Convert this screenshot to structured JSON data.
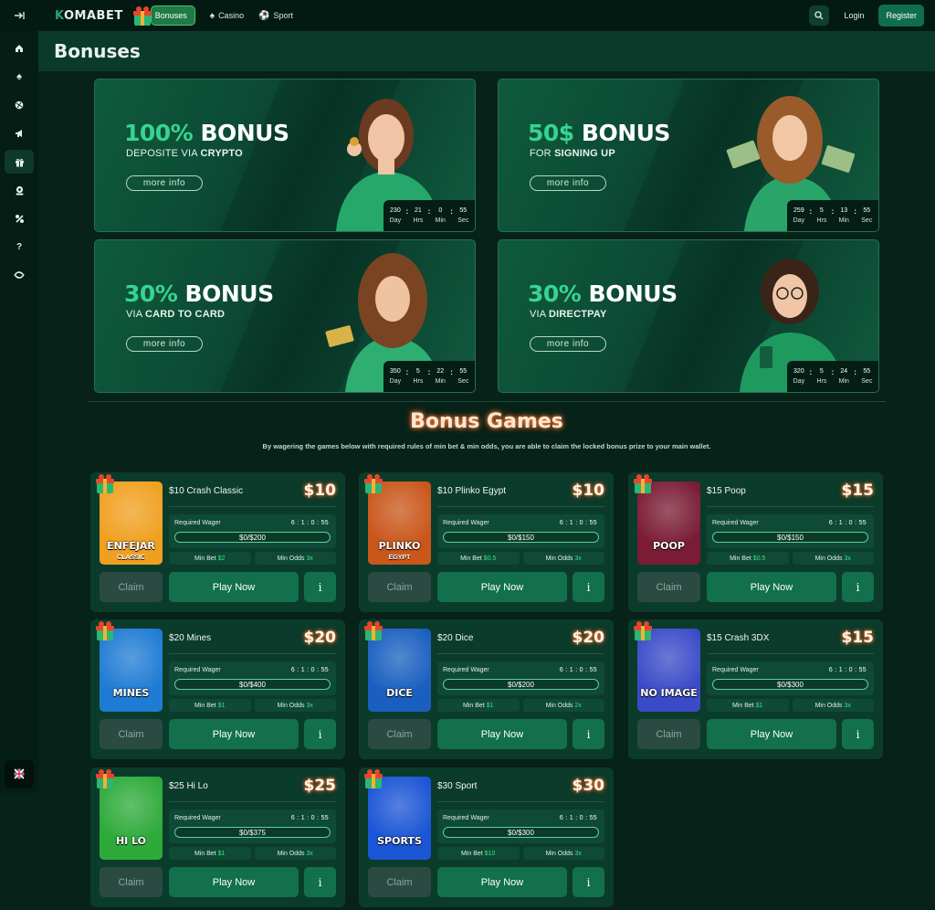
{
  "nav": {
    "logo": "KOMABET",
    "bonuses": "Bonuses",
    "casino": "Casino",
    "sport": "Sport",
    "login": "Login",
    "register": "Register"
  },
  "page": {
    "title": "Bonuses"
  },
  "banners": [
    {
      "headline": "100% BONUS",
      "sub_pre": "DEPOSITE VIA ",
      "sub_bold": "CRYPTO",
      "more": "more info",
      "timer": {
        "day": "230",
        "hrs": "21",
        "min": "0",
        "sec": "55"
      }
    },
    {
      "headline": "50$ BONUS",
      "sub_pre": "FOR ",
      "sub_bold": "SIGNING UP",
      "more": "more info",
      "timer": {
        "day": "259",
        "hrs": "5",
        "min": "13",
        "sec": "55"
      }
    },
    {
      "headline": "30% BONUS",
      "sub_pre": "VIA ",
      "sub_bold": "CARD TO CARD",
      "more": "more info",
      "timer": {
        "day": "350",
        "hrs": "5",
        "min": "22",
        "sec": "55"
      }
    },
    {
      "headline": "30% BONUS",
      "sub_pre": "VIA ",
      "sub_bold": "DIRECTPAY",
      "more": "more info",
      "timer": {
        "day": "320",
        "hrs": "5",
        "min": "24",
        "sec": "55"
      }
    }
  ],
  "timer_labels": {
    "day": "Day",
    "hrs": "Hrs",
    "min": "Min",
    "sec": "Sec"
  },
  "bonus_games": {
    "title": "Bonus Games",
    "description": "By wagering the games below with required rules of min bet & min odds, you are able to claim the locked bonus prize to your main wallet.",
    "labels": {
      "required_wager": "Required Wager",
      "min_bet": "Min Bet",
      "min_odds": "Min Odds",
      "claim": "Claim",
      "play_now": "Play Now",
      "info": "i"
    },
    "games": [
      {
        "title": "$10 Crash Classic",
        "prize": "$10",
        "time": "6 : 1 : 0 : 55",
        "progress": "$0/$200",
        "min_bet": "$2",
        "min_odds": "3x",
        "thumb_label": "ENFEJAR",
        "thumb_sub": "CLASSIC",
        "thumb_color": "#f0a020"
      },
      {
        "title": "$10 Plinko Egypt",
        "prize": "$10",
        "time": "6 : 1 : 0 : 55",
        "progress": "$0/$150",
        "min_bet": "$0.5",
        "min_odds": "3x",
        "thumb_label": "PLINKO",
        "thumb_sub": "EGYPT",
        "thumb_color": "#c9561a"
      },
      {
        "title": "$15 Poop",
        "prize": "$15",
        "time": "6 : 1 : 0 : 55",
        "progress": "$0/$150",
        "min_bet": "$0.5",
        "min_odds": "3x",
        "thumb_label": "POOP",
        "thumb_sub": "",
        "thumb_color": "#7a1c35"
      },
      {
        "title": "$20 Mines",
        "prize": "$20",
        "time": "6 : 1 : 0 : 55",
        "progress": "$0/$400",
        "min_bet": "$1",
        "min_odds": "3x",
        "thumb_label": "MINES",
        "thumb_sub": "",
        "thumb_color": "#1f7cd4"
      },
      {
        "title": "$20 Dice",
        "prize": "$20",
        "time": "6 : 1 : 0 : 55",
        "progress": "$0/$200",
        "min_bet": "$1",
        "min_odds": "2x",
        "thumb_label": "DICE",
        "thumb_sub": "",
        "thumb_color": "#1a5fc0"
      },
      {
        "title": "$15 Crash 3DX",
        "prize": "$15",
        "time": "6 : 1 : 0 : 55",
        "progress": "$0/$300",
        "min_bet": "$1",
        "min_odds": "3x",
        "thumb_label": "NO IMAGE",
        "thumb_sub": "",
        "thumb_color": "#3b4bc8"
      },
      {
        "title": "$25 Hi Lo",
        "prize": "$25",
        "time": "6 : 1 : 0 : 55",
        "progress": "$0/$375",
        "min_bet": "$1",
        "min_odds": "3x",
        "thumb_label": "HI LO",
        "thumb_sub": "",
        "thumb_color": "#2eaa3a"
      },
      {
        "title": "$30 Sport",
        "prize": "$30",
        "time": "6 : 1 : 0 : 55",
        "progress": "$0/$300",
        "min_bet": "$10",
        "min_odds": "3x",
        "thumb_label": "SPORTS",
        "thumb_sub": "",
        "thumb_color": "#1a55d6"
      }
    ]
  }
}
